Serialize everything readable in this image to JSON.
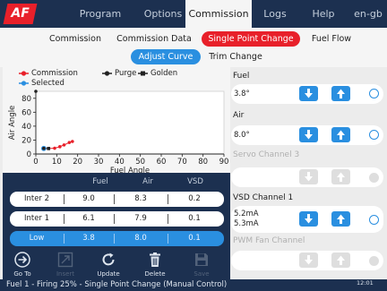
{
  "app": {
    "logo_text": "AF",
    "tabs": [
      {
        "label": "Program"
      },
      {
        "label": "Options"
      },
      {
        "label": "Commission"
      },
      {
        "label": "Logs"
      },
      {
        "label": "Help"
      },
      {
        "label": "en-gb"
      }
    ],
    "active_tab": "Commission"
  },
  "subnav": {
    "items": [
      {
        "label": "Commission"
      },
      {
        "label": "Commission Data"
      },
      {
        "label": "Single Point Change"
      },
      {
        "label": "Fuel Flow"
      }
    ],
    "active": "Single Point Change",
    "row2": [
      {
        "label": "Adjust Curve"
      },
      {
        "label": "Trim Change"
      }
    ],
    "row2_active": "Adjust Curve"
  },
  "chart_data": {
    "type": "line",
    "xlabel": "Fuel Angle",
    "ylabel": "Air Angle",
    "xlim": [
      0,
      90
    ],
    "ylim": [
      0,
      90
    ],
    "xticks": [
      0,
      10,
      20,
      30,
      40,
      50,
      60,
      70,
      80,
      90
    ],
    "yticks": [
      0,
      20,
      40,
      60,
      80
    ],
    "legend": [
      {
        "name": "Commission",
        "color": "#e8202a",
        "marker": "circle"
      },
      {
        "name": "Purge",
        "color": "#222222",
        "marker": "circle"
      },
      {
        "name": "Golden",
        "color": "#222222",
        "marker": "square"
      },
      {
        "name": "Selected",
        "color": "#2a8fe0",
        "marker": "circle"
      }
    ],
    "series": [
      {
        "name": "Commission",
        "color": "#e8202a",
        "points": [
          [
            3.8,
            8.0
          ],
          [
            6.1,
            7.9
          ],
          [
            9.0,
            8.3
          ],
          [
            11.5,
            10.5
          ],
          [
            13.5,
            13.0
          ],
          [
            16.0,
            16.5
          ],
          [
            17.5,
            18.0
          ]
        ]
      },
      {
        "name": "Purge",
        "color": "#222222",
        "points": [
          [
            0,
            90
          ]
        ]
      },
      {
        "name": "Golden",
        "color": "#222222",
        "points": [
          [
            3.8,
            8.0
          ],
          [
            6.1,
            7.9
          ]
        ]
      }
    ],
    "selected_point": [
      3.8,
      8.0
    ]
  },
  "table": {
    "headers": [
      "Fuel",
      "Air",
      "VSD"
    ],
    "rows": [
      {
        "name": "Inter 2",
        "fuel": "9.0",
        "air": "8.3",
        "vsd": "0.2",
        "selected": false
      },
      {
        "name": "Inter 1",
        "fuel": "6.1",
        "air": "7.9",
        "vsd": "0.1",
        "selected": false
      },
      {
        "name": "Low",
        "fuel": "3.8",
        "air": "8.0",
        "vsd": "0.1",
        "selected": true
      }
    ]
  },
  "toolbar": {
    "goto": "Go To",
    "insert": "Insert",
    "update": "Update",
    "delete": "Delete",
    "save": "Save"
  },
  "channels": {
    "fuel": {
      "title": "Fuel",
      "value": "3.8°"
    },
    "air": {
      "title": "Air",
      "value": "8.0°"
    },
    "servo3": {
      "title": "Servo Channel 3"
    },
    "vsd": {
      "title": "VSD Channel 1",
      "value1": "5.2mA",
      "value2": "5.3mA"
    },
    "pwm": {
      "title": "PWM Fan Channel"
    }
  },
  "status": {
    "text": "Fuel 1 - Firing 25% - Single Point Change (Manual Control)",
    "time": "12:01"
  },
  "colors": {
    "navy": "#1c3050",
    "red": "#e8202a",
    "blue": "#2a8fe0"
  }
}
